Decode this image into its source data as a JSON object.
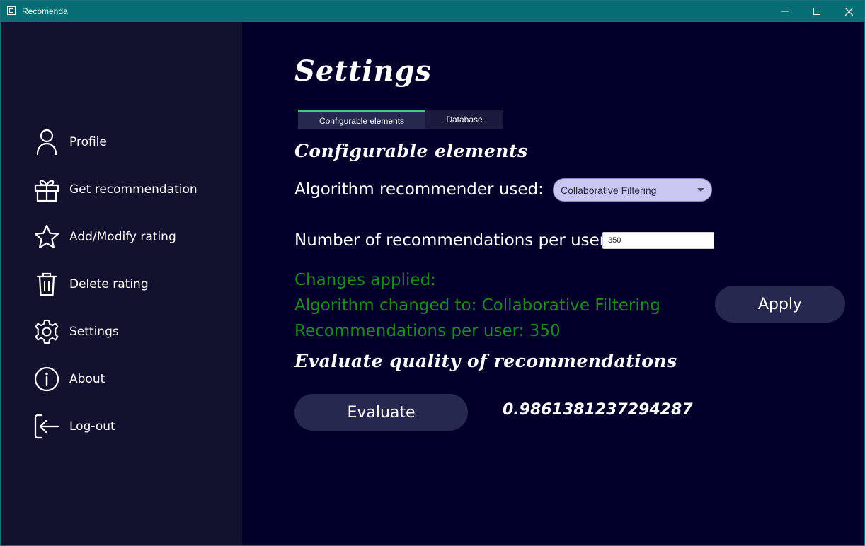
{
  "window": {
    "title": "Recomenda",
    "controls": {
      "minimize": "—",
      "maximize": "☐",
      "close": "✕"
    }
  },
  "sidebar": {
    "items": [
      {
        "label": "Profile",
        "icon": "user-icon"
      },
      {
        "label": "Get recommendation",
        "icon": "gift-icon"
      },
      {
        "label": "Add/Modify rating",
        "icon": "star-icon"
      },
      {
        "label": "Delete rating",
        "icon": "trash-icon"
      },
      {
        "label": "Settings",
        "icon": "gear-icon"
      },
      {
        "label": "About",
        "icon": "info-icon"
      },
      {
        "label": "Log-out",
        "icon": "logout-icon"
      }
    ]
  },
  "main": {
    "title": "Settings",
    "tabs": [
      {
        "label": "Configurable elements",
        "active": true
      },
      {
        "label": "Database",
        "active": false
      }
    ],
    "configurable": {
      "heading": "Configurable elements",
      "algorithm_label": "Algorithm recommender used:",
      "algorithm_value": "Collaborative Filtering",
      "num_label": "Number of recommendations per user:",
      "num_value": "350",
      "status": [
        "Changes applied:",
        "Algorithm changed to: Collaborative Filtering",
        "Recommendations per user: 350"
      ],
      "apply_label": "Apply"
    },
    "evaluate": {
      "heading": "Evaluate quality of recommendations",
      "button_label": "Evaluate",
      "score": "0.9861381237294287"
    }
  },
  "colors": {
    "titlebar": "#056d73",
    "sidebar_bg": "#12122e",
    "main_bg": "#00002a",
    "tab_active_accent": "#3ecf7a",
    "status_text": "#1f8a1f",
    "button_bg": "#262850",
    "select_bg": "#c9c6f2"
  }
}
